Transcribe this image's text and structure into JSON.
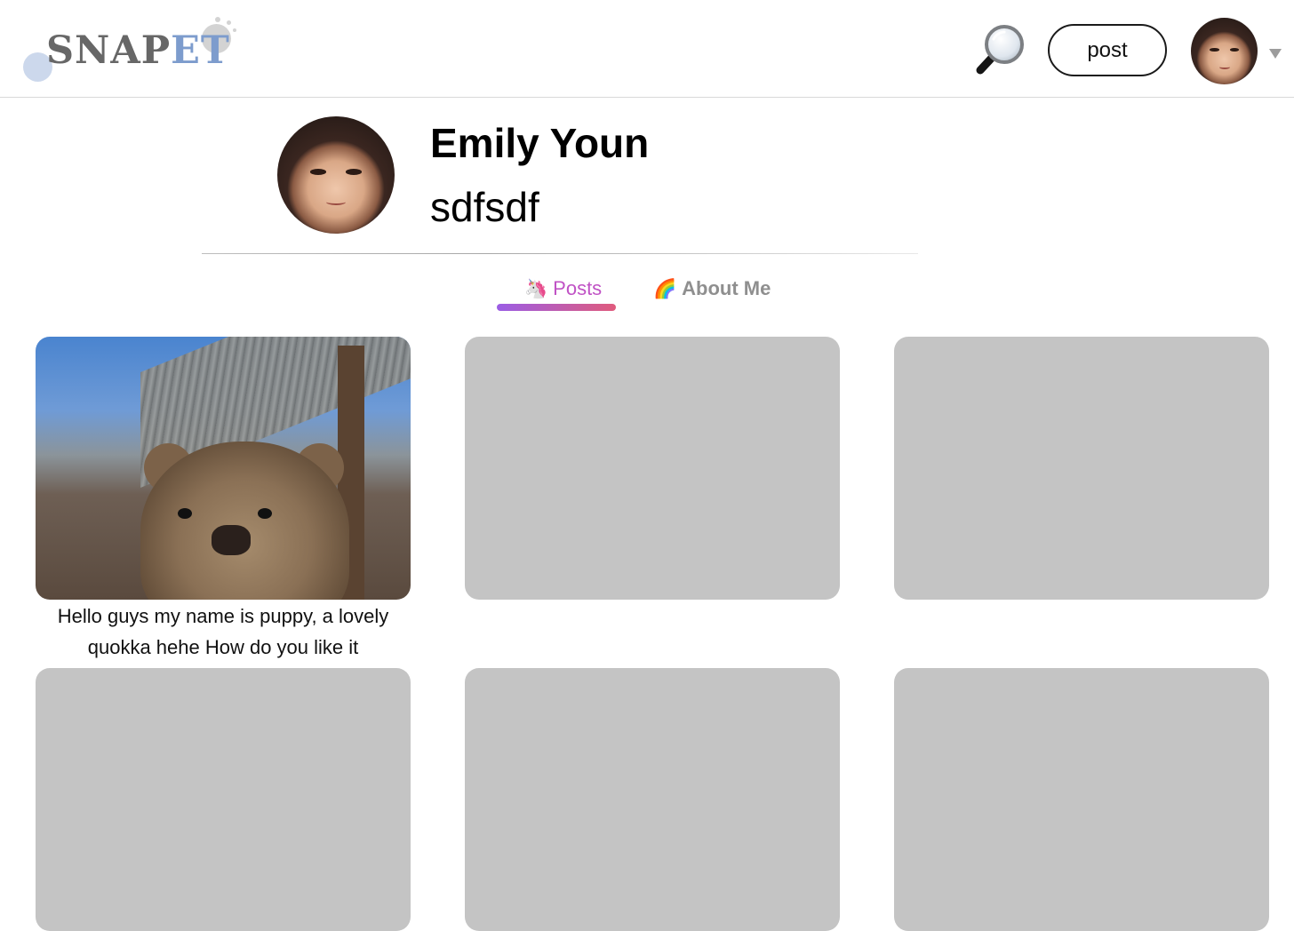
{
  "header": {
    "logo": {
      "part1": "SNAP",
      "part2": "ET"
    },
    "search_icon": "magnifying-glass-icon",
    "post_label": "post",
    "account_caret_icon": "chevron-down-icon"
  },
  "profile": {
    "name": "Emily Youn",
    "username": "sdfsdf"
  },
  "tabs": [
    {
      "emoji": "🦄",
      "label": "Posts",
      "active": true
    },
    {
      "emoji": "🌈",
      "label": "About Me",
      "active": false
    }
  ],
  "posts": [
    {
      "has_image": true,
      "caption": "Hello guys my name is puppy, a lovely quokka hehe How do you like it"
    },
    {
      "has_image": false,
      "caption": ""
    },
    {
      "has_image": false,
      "caption": ""
    },
    {
      "has_image": false,
      "caption": ""
    },
    {
      "has_image": false,
      "caption": ""
    },
    {
      "has_image": false,
      "caption": ""
    }
  ],
  "colors": {
    "logo_gray": "#676767",
    "logo_blue": "#7d9ccd",
    "active_tab": "#c052c5",
    "inactive_tab": "#8f8f8f",
    "tab_underline_start": "#9b5de5",
    "tab_underline_end": "#e05b7d",
    "placeholder_card": "#c4c4c4"
  }
}
